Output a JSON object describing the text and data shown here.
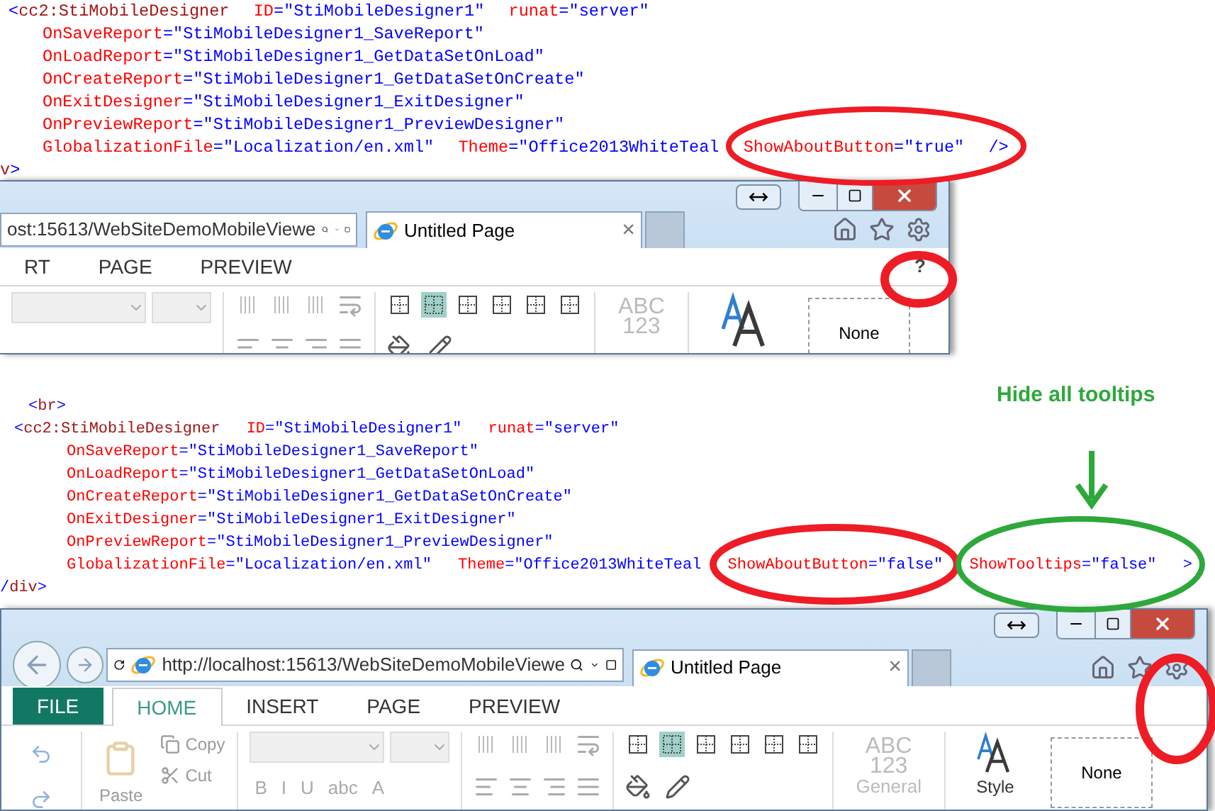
{
  "snippets": [
    {
      "lines": [
        {
          "kind": "element",
          "tokens": [
            {
              "kind": "punct",
              "text": "<"
            },
            {
              "kind": "tag",
              "text": "cc2:StiMobileDesigner"
            },
            {
              "kind": "attr",
              "text": " ID"
            },
            {
              "kind": "value",
              "text": "=\"StiMobileDesigner1\""
            },
            {
              "kind": "attr",
              "text": " runat"
            },
            {
              "kind": "value",
              "text": "=\"server\""
            }
          ]
        },
        {
          "kind": "attr",
          "tokens": [
            {
              "kind": "attr",
              "text": "OnSaveReport"
            },
            {
              "kind": "value",
              "text": "=\"StiMobileDesigner1_SaveReport\""
            }
          ]
        },
        {
          "kind": "attr",
          "tokens": [
            {
              "kind": "attr",
              "text": "OnLoadReport"
            },
            {
              "kind": "value",
              "text": "=\"StiMobileDesigner1_GetDataSetOnLoad\""
            }
          ]
        },
        {
          "kind": "attr",
          "tokens": [
            {
              "kind": "attr",
              "text": "OnCreateReport"
            },
            {
              "kind": "value",
              "text": "=\"StiMobileDesigner1_GetDataSetOnCreate\""
            }
          ]
        },
        {
          "kind": "attr",
          "tokens": [
            {
              "kind": "attr",
              "text": "OnExitDesigner"
            },
            {
              "kind": "value",
              "text": "=\"StiMobileDesigner1_ExitDesigner\""
            }
          ]
        },
        {
          "kind": "attr",
          "tokens": [
            {
              "kind": "attr",
              "text": "OnPreviewReport"
            },
            {
              "kind": "value",
              "text": "=\"StiMobileDesigner1_PreviewDesigner\""
            }
          ]
        },
        {
          "kind": "attr",
          "tokens": [
            {
              "kind": "attr",
              "text": "GlobalizationFile"
            },
            {
              "kind": "value",
              "text": "=\"Localization/en.xml\""
            },
            {
              "kind": "attr",
              "text": " Theme"
            },
            {
              "kind": "value",
              "text": "=\"Office2013WhiteTeal"
            },
            {
              "kind": "attr",
              "text": " ShowAboutButton"
            },
            {
              "kind": "value",
              "text": "=\"true\""
            },
            {
              "kind": "punct",
              "text": " />"
            }
          ]
        },
        {
          "kind": "close",
          "tokens": [
            {
              "kind": "tag",
              "text": "v"
            },
            {
              "kind": "punct",
              "text": ">"
            }
          ]
        }
      ]
    },
    {
      "lines": [
        {
          "kind": "child",
          "tokens": [
            {
              "kind": "punct",
              "text": "<"
            },
            {
              "kind": "tag",
              "text": "br"
            },
            {
              "kind": "punct",
              "text": ">"
            }
          ]
        },
        {
          "kind": "element",
          "tokens": [
            {
              "kind": "punct",
              "text": "<"
            },
            {
              "kind": "tag",
              "text": "cc2:StiMobileDesigner"
            },
            {
              "kind": "attr",
              "text": " ID"
            },
            {
              "kind": "value",
              "text": "=\"StiMobileDesigner1\""
            },
            {
              "kind": "attr",
              "text": " runat"
            },
            {
              "kind": "value",
              "text": "=\"server\""
            }
          ]
        },
        {
          "kind": "attr",
          "tokens": [
            {
              "kind": "attr",
              "text": "OnSaveReport"
            },
            {
              "kind": "value",
              "text": "=\"StiMobileDesigner1_SaveReport\""
            }
          ]
        },
        {
          "kind": "attr",
          "tokens": [
            {
              "kind": "attr",
              "text": "OnLoadReport"
            },
            {
              "kind": "value",
              "text": "=\"StiMobileDesigner1_GetDataSetOnLoad\""
            }
          ]
        },
        {
          "kind": "attr",
          "tokens": [
            {
              "kind": "attr",
              "text": "OnCreateReport"
            },
            {
              "kind": "value",
              "text": "=\"StiMobileDesigner1_GetDataSetOnCreate\""
            }
          ]
        },
        {
          "kind": "attr",
          "tokens": [
            {
              "kind": "attr",
              "text": "OnExitDesigner"
            },
            {
              "kind": "value",
              "text": "=\"StiMobileDesigner1_ExitDesigner\""
            }
          ]
        },
        {
          "kind": "attr",
          "tokens": [
            {
              "kind": "attr",
              "text": "OnPreviewReport"
            },
            {
              "kind": "value",
              "text": "=\"StiMobileDesigner1_PreviewDesigner\""
            }
          ]
        },
        {
          "kind": "attr",
          "tokens": [
            {
              "kind": "attr",
              "text": "GlobalizationFile"
            },
            {
              "kind": "value",
              "text": "=\"Localization/en.xml\""
            },
            {
              "kind": "attr",
              "text": " Theme"
            },
            {
              "kind": "value",
              "text": "=\"Office2013WhiteTeal"
            },
            {
              "kind": "attr",
              "text": " ShowAboutButton"
            },
            {
              "kind": "value",
              "text": "=\"false\""
            },
            {
              "kind": "attr",
              "text": " ShowTooltips"
            },
            {
              "kind": "value",
              "text": "=\"false\""
            },
            {
              "kind": "punct",
              "text": " >"
            }
          ]
        },
        {
          "kind": "close",
          "tokens": [
            {
              "kind": "punct",
              "text": "/"
            },
            {
              "kind": "tag",
              "text": "div"
            },
            {
              "kind": "punct",
              "text": ">"
            }
          ]
        }
      ]
    }
  ],
  "browsers": [
    {
      "nav_buttons": false,
      "address": "ost:15613/WebSiteDemoMobileViewe",
      "tab_title": "Untitled Page",
      "tab_close": "×",
      "ribbon_tabs": [
        {
          "label": "RT",
          "kind": "tab",
          "selected": false
        },
        {
          "label": "PAGE",
          "kind": "tab",
          "selected": false
        },
        {
          "label": "PREVIEW",
          "kind": "tab",
          "selected": false
        }
      ],
      "help_button": "?",
      "toolbar": {
        "number_format": [
          "ABC",
          "123"
        ],
        "style_preview": "None"
      }
    },
    {
      "nav_buttons": true,
      "address": "http://localhost:15613/WebSiteDemoMobileViewe",
      "tab_title": "Untitled Page",
      "tab_close": "×",
      "ribbon_tabs": [
        {
          "label": "FILE",
          "kind": "file",
          "selected": false
        },
        {
          "label": "HOME",
          "kind": "tab",
          "selected": true
        },
        {
          "label": "INSERT",
          "kind": "tab",
          "selected": false
        },
        {
          "label": "PAGE",
          "kind": "tab",
          "selected": false
        },
        {
          "label": "PREVIEW",
          "kind": "tab",
          "selected": false
        }
      ],
      "toolbar": {
        "clipboard": {
          "paste": "Paste",
          "copy": "Copy",
          "cut": "Cut"
        },
        "font_buttons": [
          "B",
          "I",
          "U",
          "abc",
          "A"
        ],
        "number_format": [
          "ABC",
          "123",
          "General"
        ],
        "style_label": "Style",
        "style_preview": "None"
      }
    }
  ],
  "callout": "Hide all tooltips"
}
